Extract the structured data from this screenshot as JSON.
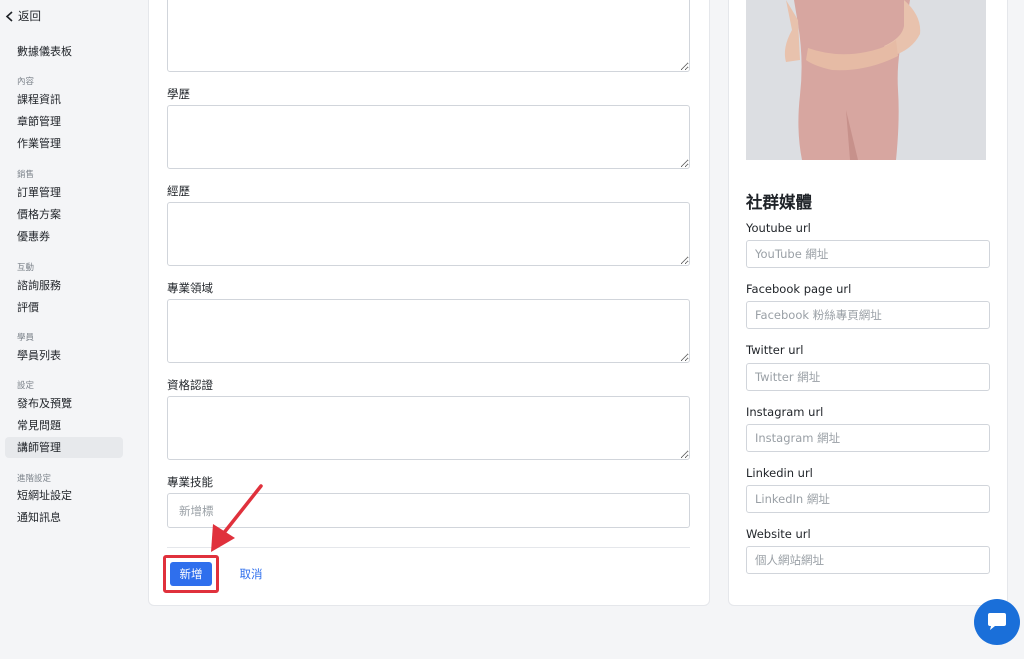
{
  "sidebar": {
    "back_label": "返回",
    "dashboard": "數據儀表板",
    "groups": {
      "content": "內容",
      "sales": "銷售",
      "interaction": "互動",
      "students": "學員",
      "settings": "設定",
      "advanced": "進階設定"
    },
    "items": {
      "course_info": "課程資訊",
      "chapters": "章節管理",
      "homework": "作業管理",
      "orders": "訂單管理",
      "pricing": "價格方案",
      "coupons": "優惠券",
      "consulting": "諮詢服務",
      "reviews": "評價",
      "student_list": "學員列表",
      "publish": "發布及預覽",
      "faq": "常見問題",
      "instructors": "講師管理",
      "short_url": "短網址設定",
      "notifications": "通知訊息"
    }
  },
  "form": {
    "education_label": "學歷",
    "experience_label": "經歷",
    "expertise_label": "專業領域",
    "certification_label": "資格認證",
    "skills_label": "專業技能",
    "skills_placeholder": "新增標",
    "submit_label": "新增",
    "cancel_label": "取消"
  },
  "social": {
    "title": "社群媒體",
    "youtube_label": "Youtube url",
    "youtube_placeholder": "YouTube 網址",
    "facebook_label": "Facebook page url",
    "facebook_placeholder": "Facebook 粉絲專頁網址",
    "twitter_label": "Twitter url",
    "twitter_placeholder": "Twitter 網址",
    "instagram_label": "Instagram url",
    "instagram_placeholder": "Instagram 網址",
    "linkedin_label": "Linkedin url",
    "linkedin_placeholder": "LinkedIn 網址",
    "website_label": "Website url",
    "website_placeholder": "個人網站網址"
  },
  "colors": {
    "accent": "#2f6fed",
    "highlight": "#e0313c",
    "chat": "#1a6fd9"
  }
}
